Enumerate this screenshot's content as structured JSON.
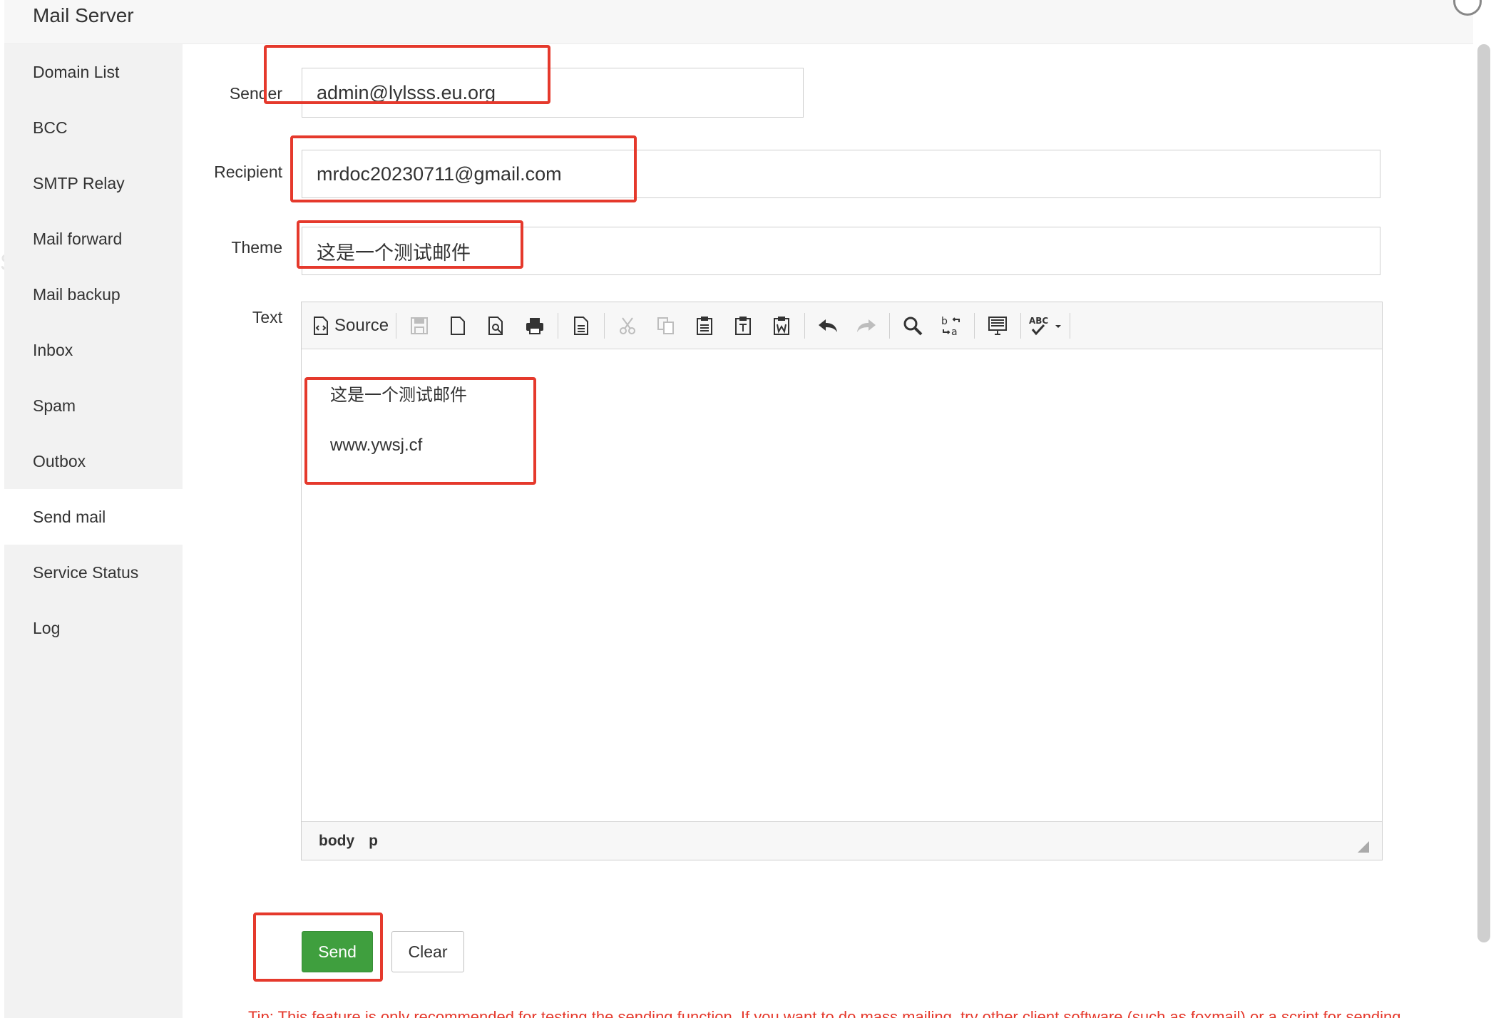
{
  "modal": {
    "title": "Mail Server"
  },
  "sidebar": {
    "items": [
      {
        "label": "Domain List"
      },
      {
        "label": "BCC"
      },
      {
        "label": "SMTP Relay"
      },
      {
        "label": "Mail forward"
      },
      {
        "label": "Mail backup"
      },
      {
        "label": "Inbox"
      },
      {
        "label": "Spam"
      },
      {
        "label": "Outbox"
      },
      {
        "label": "Send mail",
        "active": true
      },
      {
        "label": "Service Status"
      },
      {
        "label": "Log"
      }
    ]
  },
  "form": {
    "sender_label": "Sender",
    "sender_value": "admin@lylsss.eu.org",
    "recipient_label": "Recipient",
    "recipient_value": "mrdoc20230711@gmail.com",
    "theme_label": "Theme",
    "theme_value": "这是一个测试邮件",
    "text_label": "Text"
  },
  "editor": {
    "source_label": "Source",
    "content_lines": [
      "这是一个测试邮件",
      "www.ywsj.cf"
    ],
    "path": [
      "body",
      "p"
    ]
  },
  "icons": [
    "source-icon",
    "save-icon",
    "new-page-icon",
    "preview-icon",
    "print-icon",
    "templates-icon",
    "cut-icon",
    "copy-icon",
    "paste-icon",
    "paste-text-icon",
    "paste-word-icon",
    "undo-icon",
    "redo-icon",
    "find-icon",
    "replace-icon",
    "select-all-icon",
    "spellcheck-icon"
  ],
  "actions": {
    "send_label": "Send",
    "clear_label": "Clear"
  },
  "tip": "Tip: This feature is only recommended for testing the sending function. If you want to do mass mailing, try other client software (such as foxmail) or a script for sending",
  "colors": {
    "accent_green": "#3f9f3e",
    "highlight_red": "#e5392c",
    "sidebar_bg": "#f2f2f2"
  }
}
